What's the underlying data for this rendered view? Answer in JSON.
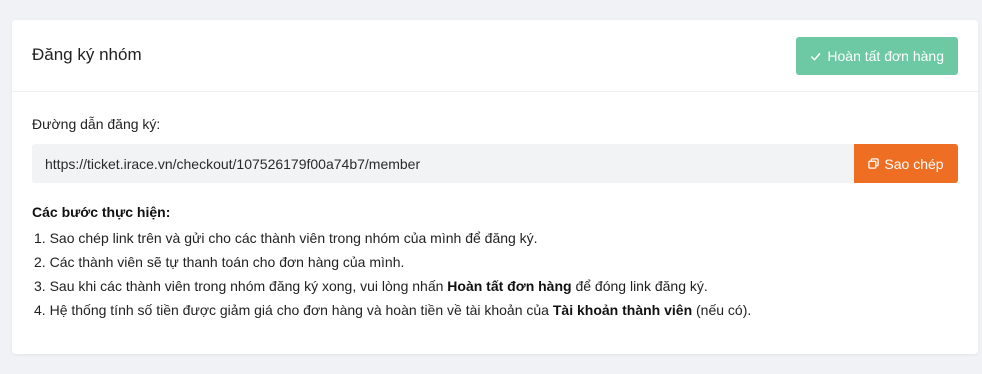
{
  "card": {
    "title": "Đăng ký nhóm",
    "complete_button": "Hoàn tất đơn hàng",
    "link_label": "Đường dẫn đăng ký:",
    "link_value": "https://ticket.irace.vn/checkout/107526179f00a74b7/member",
    "copy_button": "Sao chép",
    "steps_title": "Các bước thực hiện:",
    "steps": [
      {
        "num": "1.",
        "text": "Sao chép link trên và gửi cho các thành viên trong nhóm của mình để đăng ký."
      },
      {
        "num": "2.",
        "text": "Các thành viên sẽ tự thanh toán cho đơn hàng của mình."
      },
      {
        "num": "3.",
        "pre": "Sau khi các thành viên trong nhóm đăng ký xong, vui lòng nhấn ",
        "bold": "Hoàn tất đơn hàng",
        "post": " để đóng link đăng ký."
      },
      {
        "num": "4.",
        "pre": "Hệ thống tính số tiền được giảm giá cho đơn hàng và hoàn tiền về tài khoản của ",
        "bold": "Tài khoản thành viên",
        "post": " (nếu có)."
      }
    ]
  },
  "icons": {
    "complete": "check-icon",
    "copy": "copy-icon"
  },
  "colors": {
    "complete_button": "#6cc9a3",
    "copy_button": "#ee6f24",
    "input_bg": "#f2f3f5"
  }
}
